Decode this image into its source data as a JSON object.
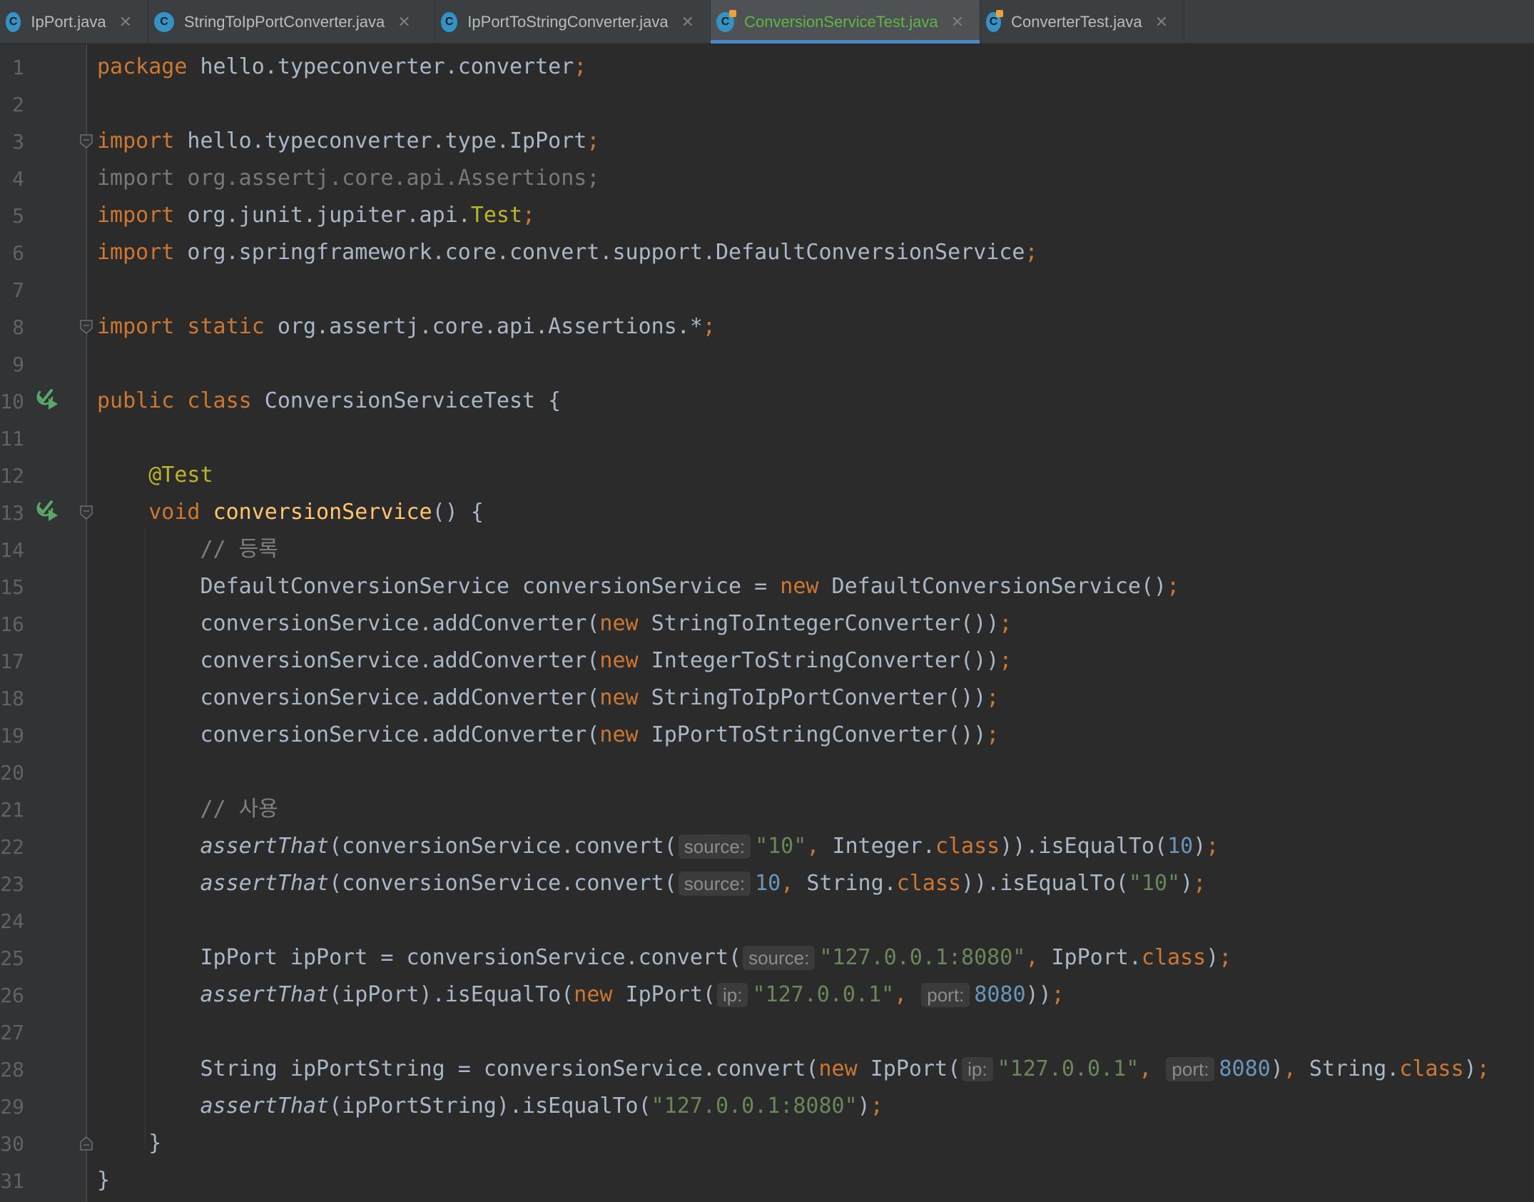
{
  "tabs": [
    {
      "label": "IpPort.java",
      "icon": "class-icon",
      "active": false
    },
    {
      "label": "StringToIpPortConverter.java",
      "icon": "class-icon",
      "active": false
    },
    {
      "label": "IpPortToStringConverter.java",
      "icon": "class-icon",
      "active": false
    },
    {
      "label": "ConversionServiceTest.java",
      "icon": "test-class-icon",
      "active": true
    },
    {
      "label": "ConverterTest.java",
      "icon": "test-class-icon",
      "active": false
    }
  ],
  "tab_icon_letter": "C",
  "close_glyph": "✕",
  "colors": {
    "background": "#2b2b2b",
    "keyword": "#cc7832",
    "string": "#6a8759",
    "number": "#6897bb",
    "annotation": "#bbb529",
    "function": "#ffc66d",
    "comment": "#808080",
    "active_tab_text": "#62b543",
    "active_tab_underline": "#4a88c7"
  },
  "gutter_icons": [
    {
      "line": 10,
      "icon": "run-test-icon"
    },
    {
      "line": 13,
      "icon": "run-test-icon"
    }
  ],
  "code_lines": [
    {
      "n": "1",
      "tokens": [
        {
          "t": "package",
          "c": "kw"
        },
        {
          "t": " hello.typeconverter.converter"
        },
        {
          "t": ";",
          "c": "kw"
        }
      ]
    },
    {
      "n": "2",
      "tokens": []
    },
    {
      "n": "3",
      "tokens": [
        {
          "t": "import",
          "c": "kw"
        },
        {
          "t": " hello.typeconverter.type.IpPort"
        },
        {
          "t": ";",
          "c": "kw"
        }
      ]
    },
    {
      "n": "4",
      "tokens": [
        {
          "t": "import org.assertj.core.api.Assertions;",
          "c": "gray"
        }
      ]
    },
    {
      "n": "5",
      "tokens": [
        {
          "t": "import",
          "c": "kw"
        },
        {
          "t": " org.junit.jupiter.api."
        },
        {
          "t": "Test",
          "c": "ann"
        },
        {
          "t": ";",
          "c": "kw"
        }
      ]
    },
    {
      "n": "6",
      "tokens": [
        {
          "t": "import",
          "c": "kw"
        },
        {
          "t": " org.springframework.core.convert.support.DefaultConversionService"
        },
        {
          "t": ";",
          "c": "kw"
        }
      ]
    },
    {
      "n": "7",
      "tokens": []
    },
    {
      "n": "8",
      "tokens": [
        {
          "t": "import static",
          "c": "kw"
        },
        {
          "t": " org.assertj.core.api.Assertions.*"
        },
        {
          "t": ";",
          "c": "kw"
        }
      ]
    },
    {
      "n": "9",
      "tokens": []
    },
    {
      "n": "10",
      "tokens": [
        {
          "t": "public class",
          "c": "kw"
        },
        {
          "t": " ConversionServiceTest {"
        }
      ]
    },
    {
      "n": "11",
      "tokens": []
    },
    {
      "n": "12",
      "tokens": [
        {
          "t": "    "
        },
        {
          "t": "@Test",
          "c": "ann"
        }
      ]
    },
    {
      "n": "13",
      "tokens": [
        {
          "t": "    "
        },
        {
          "t": "void",
          "c": "kw"
        },
        {
          "t": " "
        },
        {
          "t": "conversionService",
          "c": "fn"
        },
        {
          "t": "() {"
        }
      ]
    },
    {
      "n": "14",
      "tokens": [
        {
          "t": "        "
        },
        {
          "t": "// 등록",
          "c": "cmt"
        }
      ]
    },
    {
      "n": "15",
      "tokens": [
        {
          "t": "        DefaultConversionService conversionService = "
        },
        {
          "t": "new",
          "c": "kw"
        },
        {
          "t": " DefaultConversionService()"
        },
        {
          "t": ";",
          "c": "kw"
        }
      ]
    },
    {
      "n": "16",
      "tokens": [
        {
          "t": "        conversionService.addConverter("
        },
        {
          "t": "new",
          "c": "kw"
        },
        {
          "t": " StringToIntegerConverter())"
        },
        {
          "t": ";",
          "c": "kw"
        }
      ]
    },
    {
      "n": "17",
      "tokens": [
        {
          "t": "        conversionService.addConverter("
        },
        {
          "t": "new",
          "c": "kw"
        },
        {
          "t": " IntegerToStringConverter())"
        },
        {
          "t": ";",
          "c": "kw"
        }
      ]
    },
    {
      "n": "18",
      "tokens": [
        {
          "t": "        conversionService.addConverter("
        },
        {
          "t": "new",
          "c": "kw"
        },
        {
          "t": " StringToIpPortConverter())"
        },
        {
          "t": ";",
          "c": "kw"
        }
      ]
    },
    {
      "n": "19",
      "tokens": [
        {
          "t": "        conversionService.addConverter("
        },
        {
          "t": "new",
          "c": "kw"
        },
        {
          "t": " IpPortToStringConverter())"
        },
        {
          "t": ";",
          "c": "kw"
        }
      ]
    },
    {
      "n": "20",
      "tokens": []
    },
    {
      "n": "21",
      "tokens": [
        {
          "t": "        "
        },
        {
          "t": "// 사용",
          "c": "cmt"
        }
      ]
    },
    {
      "n": "22",
      "tokens": [
        {
          "t": "        "
        },
        {
          "t": "assertThat",
          "c": "ital"
        },
        {
          "t": "(conversionService.convert("
        },
        {
          "t": "source:",
          "c": "hint"
        },
        {
          "t": "\"10\"",
          "c": "str"
        },
        {
          "t": ", ",
          "c": "kw"
        },
        {
          "t": "Integer."
        },
        {
          "t": "class",
          "c": "kw"
        },
        {
          "t": ")).isEqualTo("
        },
        {
          "t": "10",
          "c": "num"
        },
        {
          "t": ")"
        },
        {
          "t": ";",
          "c": "kw"
        }
      ]
    },
    {
      "n": "23",
      "tokens": [
        {
          "t": "        "
        },
        {
          "t": "assertThat",
          "c": "ital"
        },
        {
          "t": "(conversionService.convert("
        },
        {
          "t": "source:",
          "c": "hint"
        },
        {
          "t": "10",
          "c": "num"
        },
        {
          "t": ", ",
          "c": "kw"
        },
        {
          "t": "String."
        },
        {
          "t": "class",
          "c": "kw"
        },
        {
          "t": ")).isEqualTo("
        },
        {
          "t": "\"10\"",
          "c": "str"
        },
        {
          "t": ")"
        },
        {
          "t": ";",
          "c": "kw"
        }
      ]
    },
    {
      "n": "24",
      "tokens": []
    },
    {
      "n": "25",
      "tokens": [
        {
          "t": "        IpPort ipPort = conversionService.convert("
        },
        {
          "t": "source:",
          "c": "hint"
        },
        {
          "t": "\"127.0.0.1:8080\"",
          "c": "str"
        },
        {
          "t": ", ",
          "c": "kw"
        },
        {
          "t": "IpPort."
        },
        {
          "t": "class",
          "c": "kw"
        },
        {
          "t": ")"
        },
        {
          "t": ";",
          "c": "kw"
        }
      ]
    },
    {
      "n": "26",
      "tokens": [
        {
          "t": "        "
        },
        {
          "t": "assertThat",
          "c": "ital"
        },
        {
          "t": "(ipPort).isEqualTo("
        },
        {
          "t": "new",
          "c": "kw"
        },
        {
          "t": " IpPort("
        },
        {
          "t": "ip:",
          "c": "hint"
        },
        {
          "t": "\"127.0.0.1\"",
          "c": "str"
        },
        {
          "t": ", ",
          "c": "kw"
        },
        {
          "t": "port:",
          "c": "hint"
        },
        {
          "t": "8080",
          "c": "num"
        },
        {
          "t": "))"
        },
        {
          "t": ";",
          "c": "kw"
        }
      ]
    },
    {
      "n": "27",
      "tokens": []
    },
    {
      "n": "28",
      "tokens": [
        {
          "t": "        String ipPortString = conversionService.convert("
        },
        {
          "t": "new",
          "c": "kw"
        },
        {
          "t": " IpPort("
        },
        {
          "t": "ip:",
          "c": "hint"
        },
        {
          "t": "\"127.0.0.1\"",
          "c": "str"
        },
        {
          "t": ", ",
          "c": "kw"
        },
        {
          "t": "port:",
          "c": "hint"
        },
        {
          "t": "8080",
          "c": "num"
        },
        {
          "t": ")"
        },
        {
          "t": ", ",
          "c": "kw"
        },
        {
          "t": "String."
        },
        {
          "t": "class",
          "c": "kw"
        },
        {
          "t": ")"
        },
        {
          "t": ";",
          "c": "kw"
        }
      ]
    },
    {
      "n": "29",
      "tokens": [
        {
          "t": "        "
        },
        {
          "t": "assertThat",
          "c": "ital"
        },
        {
          "t": "(ipPortString).isEqualTo("
        },
        {
          "t": "\"127.0.0.1:8080\"",
          "c": "str"
        },
        {
          "t": ")"
        },
        {
          "t": ";",
          "c": "kw"
        }
      ]
    },
    {
      "n": "30",
      "tokens": [
        {
          "t": "    }"
        }
      ]
    },
    {
      "n": "31",
      "tokens": [
        {
          "t": "}"
        }
      ]
    }
  ]
}
